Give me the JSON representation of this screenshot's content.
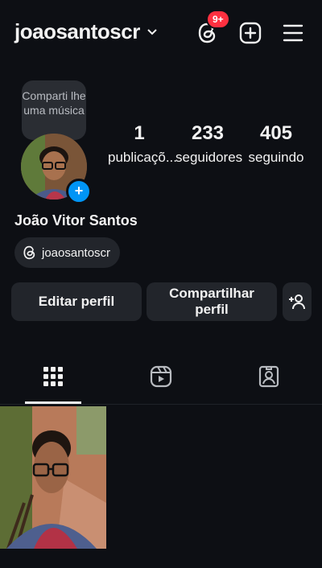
{
  "header": {
    "username": "joaosantoscr",
    "threads_badge": "9+",
    "icons": [
      "threads-icon",
      "new-post-icon",
      "menu-icon"
    ]
  },
  "note": {
    "text": "Comparti lhe uma música"
  },
  "profile": {
    "full_name": "João Vitor Santos",
    "threads_handle": "joaosantoscr",
    "stats": [
      {
        "value": "1",
        "label": "publicaçõ..."
      },
      {
        "value": "233",
        "label": "seguidores"
      },
      {
        "value": "405",
        "label": "seguindo"
      }
    ]
  },
  "actions": {
    "edit": "Editar perfil",
    "share": "Compartilhar perfil"
  },
  "tabs": [
    "grid-icon",
    "reels-icon",
    "tagged-icon"
  ],
  "colors": {
    "background": "#0d0f14",
    "badge": "#ff3040",
    "accent": "#0095f6",
    "button": "#22252b"
  }
}
